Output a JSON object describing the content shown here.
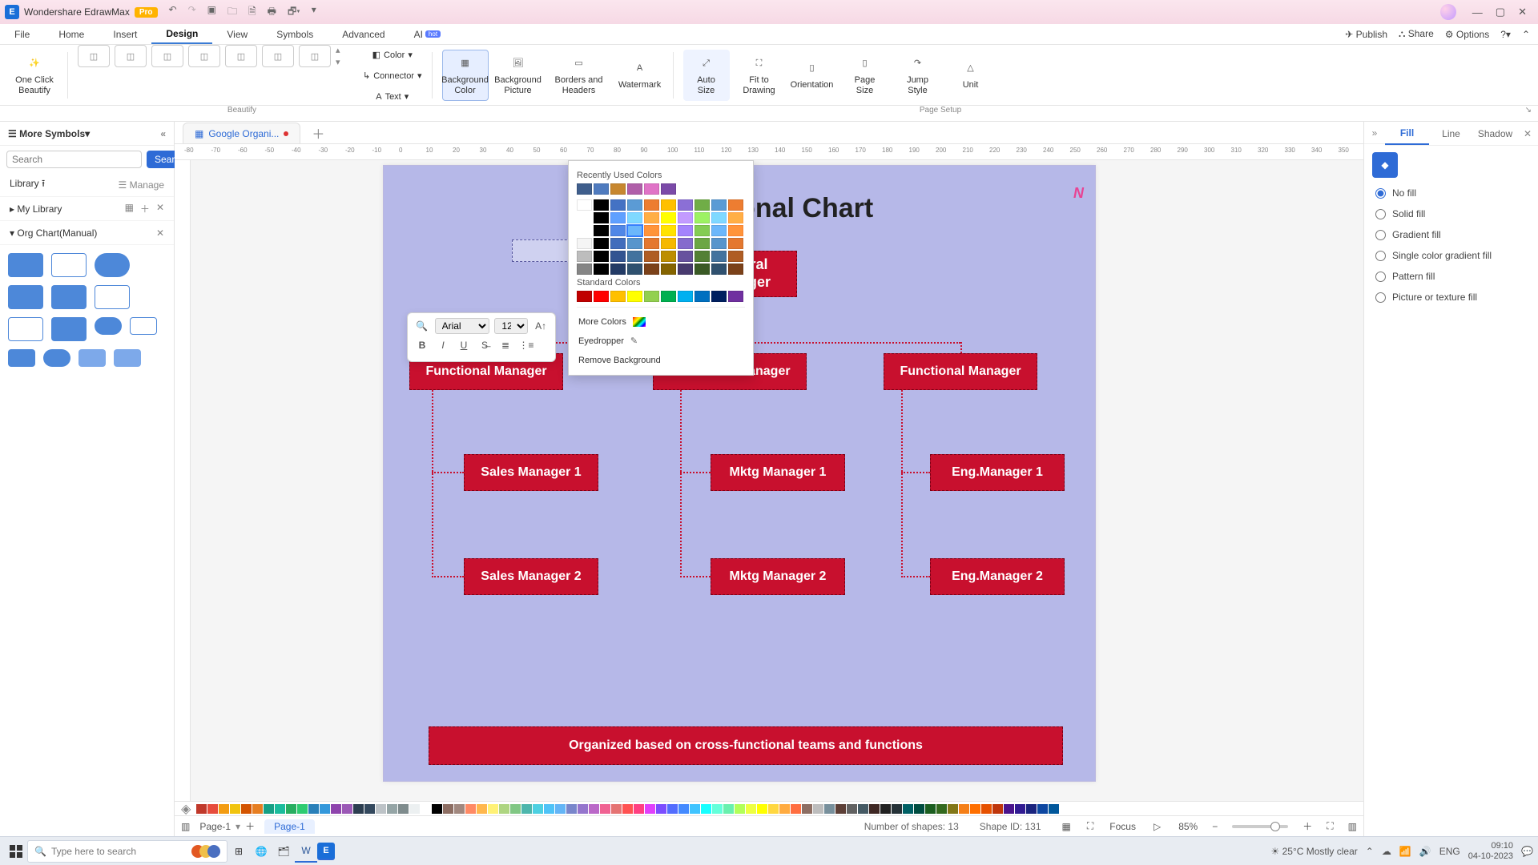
{
  "app": {
    "title": "Wondershare EdrawMax",
    "pro": "Pro"
  },
  "menu": {
    "items": [
      "File",
      "Home",
      "Insert",
      "Design",
      "View",
      "Symbols",
      "Advanced",
      "AI"
    ],
    "active": "Design",
    "right": {
      "publish": "Publish",
      "share": "Share",
      "options": "Options"
    }
  },
  "ribbon": {
    "oneclick": "One Click\nBeautify",
    "color": "Color",
    "connector": "Connector",
    "text": "Text",
    "bgcolor": "Background\nColor",
    "bgpic": "Background\nPicture",
    "borders": "Borders and\nHeaders",
    "watermark": "Watermark",
    "autosize": "Auto\nSize",
    "fit": "Fit to\nDrawing",
    "orient": "Orientation",
    "pagesize": "Page\nSize",
    "jump": "Jump\nStyle",
    "unit": "Unit",
    "group_beautify": "Beautify",
    "group_pagesetup": "Page Setup"
  },
  "doc_tab": {
    "name": "Google Organi..."
  },
  "leftpanel": {
    "head": "More Symbols",
    "search_ph": "Search",
    "search_btn": "Search",
    "library": "Library",
    "manage": "Manage",
    "mylib": "My Library",
    "section": "Org Chart(Manual)"
  },
  "chart": {
    "title": "Organizational Chart",
    "title_visible_fragment": "ational Chart",
    "root": "General\nManager",
    "root_visible": "al\ner",
    "l1": [
      "Functional Manager",
      "Functional Manager",
      "Functional Manager"
    ],
    "l2": [
      "Sales Manager 1",
      "Mktg Manager 1",
      "Eng.Manager 1"
    ],
    "l3": [
      "Sales Manager 2",
      "Mktg Manager 2",
      "Eng.Manager 2"
    ],
    "footer": "Organized based on cross-functional teams and functions"
  },
  "minitb": {
    "font": "Arial",
    "size": "12"
  },
  "dropdown": {
    "recent": "Recently Used Colors",
    "standard": "Standard Colors",
    "more": "More Colors",
    "eyedrop": "Eyedropper",
    "remove": "Remove Background",
    "recent_colors": [
      "#3f5e8c",
      "#4f7bbf",
      "#c7872f",
      "#b05fa9",
      "#e073c7",
      "#7b4aa8"
    ],
    "theme_row1": [
      "#ffffff",
      "#000000",
      "#4472c4",
      "#5b9bd5",
      "#ed7d31",
      "#ffc000",
      "#8b6fd6",
      "#70ad47",
      "#5b9bd5",
      "#ed7d31"
    ],
    "standard_colors": [
      "#c00000",
      "#ff0000",
      "#ffc000",
      "#ffff00",
      "#92d050",
      "#00b050",
      "#00b0f0",
      "#0070c0",
      "#002060",
      "#7030a0"
    ]
  },
  "rightpanel": {
    "tabs": [
      "Fill",
      "Line",
      "Shadow"
    ],
    "active": "Fill",
    "opts": [
      "No fill",
      "Solid fill",
      "Gradient fill",
      "Single color gradient fill",
      "Pattern fill",
      "Picture or texture fill"
    ],
    "selected": "No fill"
  },
  "status": {
    "page_sel": "Page-1",
    "page_tab": "Page-1",
    "shapes": "Number of shapes: 13",
    "shapeid": "Shape ID: 131",
    "focus": "Focus",
    "zoom": "85%"
  },
  "taskbar": {
    "search_ph": "Type here to search",
    "temp": "25°C",
    "weather": "Mostly clear",
    "time": "09:10",
    "date": "04-10-2023"
  },
  "quickcolors": [
    "#c0392b",
    "#e74c3c",
    "#f39c12",
    "#f1c40f",
    "#d35400",
    "#e67e22",
    "#16a085",
    "#1abc9c",
    "#27ae60",
    "#2ecc71",
    "#2980b9",
    "#3498db",
    "#8e44ad",
    "#9b59b6",
    "#2c3e50",
    "#34495e",
    "#bdc3c7",
    "#95a5a6",
    "#7f8c8d",
    "#ecf0f1",
    "#ffffff",
    "#000000",
    "#8d6e63",
    "#a1887f",
    "#ff8a65",
    "#ffb74d",
    "#fff176",
    "#aed581",
    "#81c784",
    "#4db6ac",
    "#4dd0e1",
    "#4fc3f7",
    "#64b5f6",
    "#7986cb",
    "#9575cd",
    "#ba68c8",
    "#f06292",
    "#e57373",
    "#ff5252",
    "#ff4081",
    "#e040fb",
    "#7c4dff",
    "#536dfe",
    "#448aff",
    "#40c4ff",
    "#18ffff",
    "#64ffda",
    "#69f0ae",
    "#b2ff59",
    "#eeff41",
    "#ffff00",
    "#ffd740",
    "#ffab40",
    "#ff6e40",
    "#8d6e63",
    "#bdbdbd",
    "#78909c",
    "#5d4037",
    "#616161",
    "#455a64",
    "#3e2723",
    "#212121",
    "#263238",
    "#006064",
    "#004d40",
    "#1b5e20",
    "#33691e",
    "#827717",
    "#f57f17",
    "#ff6f00",
    "#e65100",
    "#bf360c",
    "#4a148c",
    "#311b92",
    "#1a237e",
    "#0d47a1",
    "#01579b"
  ]
}
